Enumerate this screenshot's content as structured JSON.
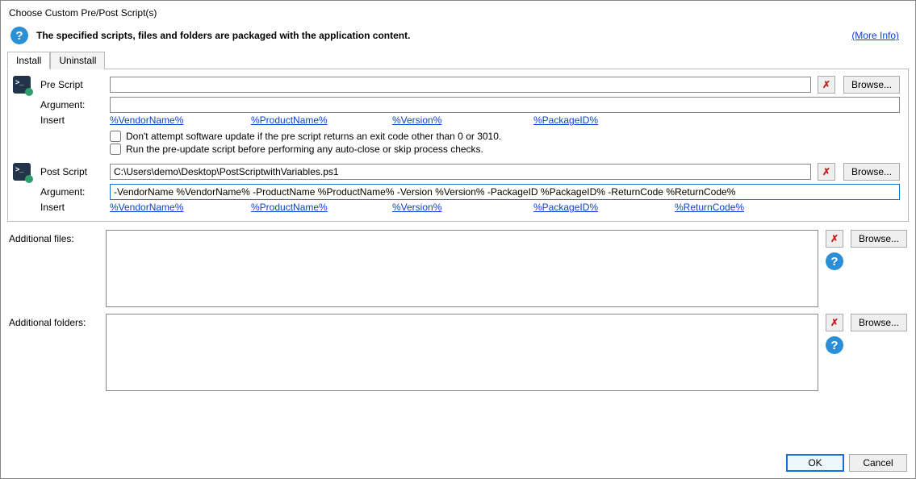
{
  "title": "Choose Custom Pre/Post Script(s)",
  "info_text": "The specified scripts, files and folders are packaged with the application content.",
  "more_info": "(More Info)",
  "tabs": {
    "install": "Install",
    "uninstall": "Uninstall"
  },
  "labels": {
    "pre_script": "Pre Script",
    "post_script": "Post Script",
    "argument": "Argument:",
    "insert": "Insert",
    "additional_files": "Additional files:",
    "additional_folders": "Additional folders:"
  },
  "buttons": {
    "browse": "Browse...",
    "delete_glyph": "✗",
    "ok": "OK",
    "cancel": "Cancel"
  },
  "pre": {
    "script_value": "",
    "argument_value": "",
    "insert_links": [
      "%VendorName%",
      "%ProductName%",
      "%Version%",
      "%PackageID%"
    ],
    "check1": "Don't attempt software update if the pre script returns an exit code other than 0 or 3010.",
    "check2": "Run the pre-update script before performing any auto-close or skip process checks."
  },
  "post": {
    "script_value": "C:\\Users\\demo\\Desktop\\PostScriptwithVariables.ps1",
    "argument_value": "-VendorName %VendorName% -ProductName %ProductName% -Version %Version% -PackageID %PackageID% -ReturnCode %ReturnCode%",
    "insert_links": [
      "%VendorName%",
      "%ProductName%",
      "%Version%",
      "%PackageID%",
      "%ReturnCode%"
    ]
  },
  "additional_files_value": "",
  "additional_folders_value": ""
}
